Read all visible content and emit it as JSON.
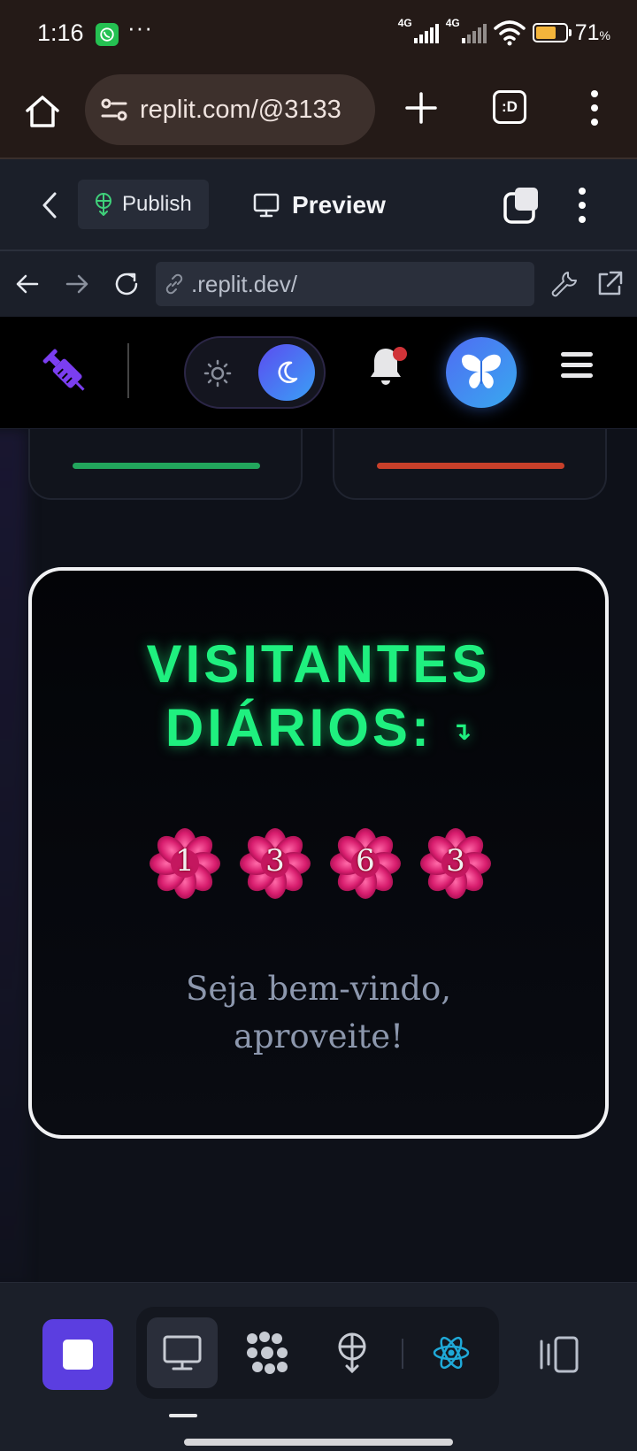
{
  "status_bar": {
    "time": "1:16",
    "dots": "···",
    "network_1": "4G",
    "network_2": "4G",
    "battery_percent": "71",
    "battery_unit": "%",
    "battery_level": 0.71
  },
  "browser": {
    "url": "replit.com/@3133",
    "tabs_label": ":D"
  },
  "replit_toolbar": {
    "publish_label": "Publish",
    "preview_label": "Preview"
  },
  "webview": {
    "url": ".replit.dev/"
  },
  "page": {
    "stat_cards": [
      {
        "bar_color": "#22a55c"
      },
      {
        "bar_color": "#c8402a"
      }
    ],
    "visitor_card": {
      "title_line1": "VISITANTES",
      "title_line2": "DIÁRIOS:",
      "arrow": "↴",
      "digits": [
        "1",
        "3",
        "6",
        "3"
      ],
      "welcome_line1": "Seja bem-vindo,",
      "welcome_line2": "aproveite!"
    }
  },
  "colors": {
    "accent_green": "#1ff07f",
    "stop_purple": "#5b3ee0",
    "react_blue": "#1fa9d8"
  },
  "icons": [
    "whatsapp-icon",
    "home-icon",
    "site-settings-icon",
    "plus-icon",
    "more-vertical-icon",
    "chevron-left-icon",
    "publish-icon",
    "monitor-icon",
    "window-icon",
    "arrow-left-icon",
    "arrow-right-icon",
    "refresh-icon",
    "link-icon",
    "wrench-icon",
    "open-external-icon",
    "syringe-icon",
    "sun-icon",
    "moon-icon",
    "bell-icon",
    "butterfly-icon",
    "menu-icon",
    "stop-icon",
    "react-icon"
  ]
}
